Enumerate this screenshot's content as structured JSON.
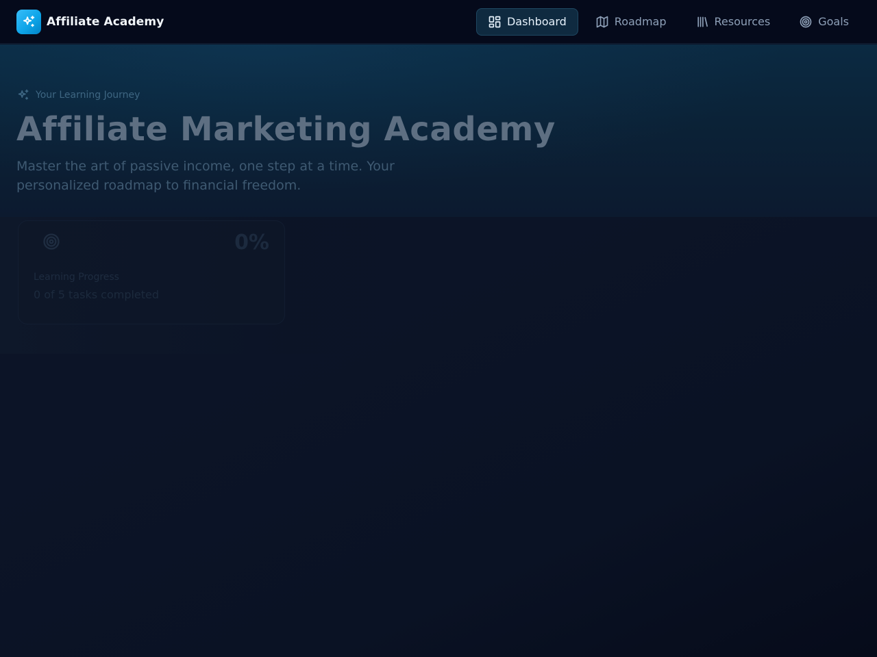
{
  "brand": {
    "name": "Affiliate Academy",
    "icon": "sparkles-icon"
  },
  "nav": {
    "items": [
      {
        "label": "Dashboard",
        "icon": "layout-dashboard-icon",
        "active": true
      },
      {
        "label": "Roadmap",
        "icon": "map-icon",
        "active": false
      },
      {
        "label": "Resources",
        "icon": "library-icon",
        "active": false
      },
      {
        "label": "Goals",
        "icon": "target-icon",
        "active": false
      }
    ]
  },
  "hero": {
    "eyebrow": "Your Learning Journey",
    "title": "Affiliate Marketing Academy",
    "subtitle": "Master the art of passive income, one step at a time. Your personalized roadmap to financial freedom."
  },
  "progress_card": {
    "percent_label": "0%",
    "progress_fraction": 0,
    "label": "Learning Progress",
    "detail": "0 of 5 tasks completed",
    "icon": "target-icon"
  },
  "colors": {
    "accent": "#0ea5e9",
    "nav_background": "#050a1b",
    "page_background": "#0c1427"
  }
}
